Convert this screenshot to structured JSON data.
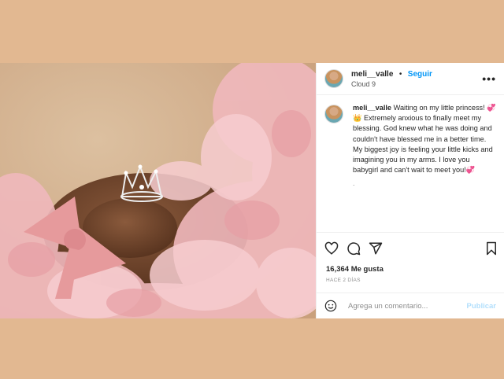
{
  "colors": {
    "page_background": "#e2b891",
    "link_blue": "#0095f6",
    "publish_disabled": "#b2dffc"
  },
  "header": {
    "username": "meli__valle",
    "separator": "•",
    "follow_label": "Seguir",
    "location": "Cloud 9",
    "more_icon": "more-icon"
  },
  "caption": {
    "username": "meli__valle",
    "text": "Waiting on my little princess! 💞👑 Extremely anxious to finally meet my blessing. God knew what he was doing and couldn't have blessed me in a better time. My biggest joy is feeling your little kicks and imagining you in my arms. I love you babygirl and can't wait to meet you!💞",
    "trailing_dot": "."
  },
  "actions": {
    "icons": [
      "heart-icon",
      "comment-icon",
      "share-icon",
      "bookmark-icon"
    ]
  },
  "stats": {
    "likes": "16,364 Me gusta",
    "time_ago": "HACE 2 DÍAS"
  },
  "comment_box": {
    "placeholder": "Agrega un comentario...",
    "emoji_icon": "smiley-icon",
    "publish_label": "Publicar"
  }
}
